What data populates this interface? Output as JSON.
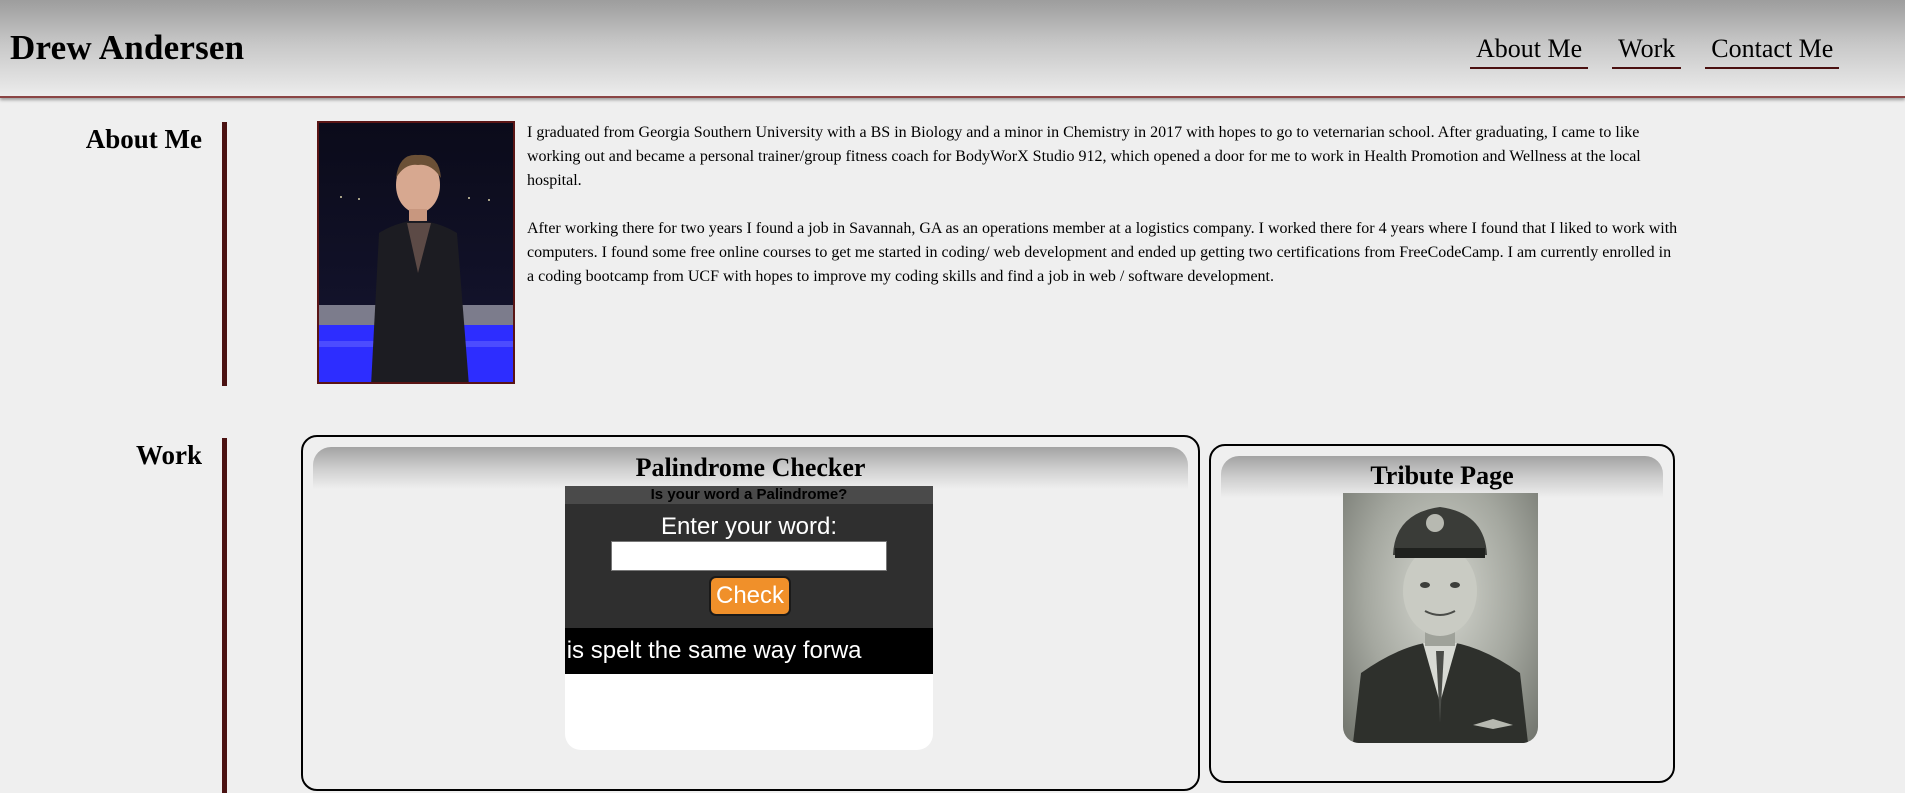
{
  "header": {
    "brand": "Drew Andersen",
    "nav": [
      "About Me",
      "Work",
      "Contact Me"
    ]
  },
  "about": {
    "title": "About Me",
    "paragraphs": [
      "I graduated from Georgia Southern University with a BS in Biology and a minor in Chemistry in 2017 with hopes to go to veternarian school. After graduating, I came to like working out and became a personal trainer/group fitness coach for BodyWorX Studio 912, which opened a door for me to work in Health Promotion and Wellness at the local hospital.",
      "After working there for two years I found a job in Savannah, GA as an operations member at a logistics company. I worked there for 4 years where I found that I liked to work with computers. I found some free online courses to get me started in coding/ web development and ended up getting two certifications from FreeCodeCamp. I am currently enrolled in a coding bootcamp from UCF with hopes to improve my coding skills and find a job in web / software development."
    ]
  },
  "work": {
    "title": "Work",
    "projects": [
      {
        "title": "Palindrome Checker",
        "preview": {
          "question": "Is your word a Palindrome?",
          "prompt": "Enter your word:",
          "button": "Check",
          "marquee": "d that is spelt the same way forwa"
        }
      },
      {
        "title": "Tribute Page"
      }
    ]
  },
  "colors": {
    "accent": "#4b1212",
    "button": "#f0902a"
  }
}
